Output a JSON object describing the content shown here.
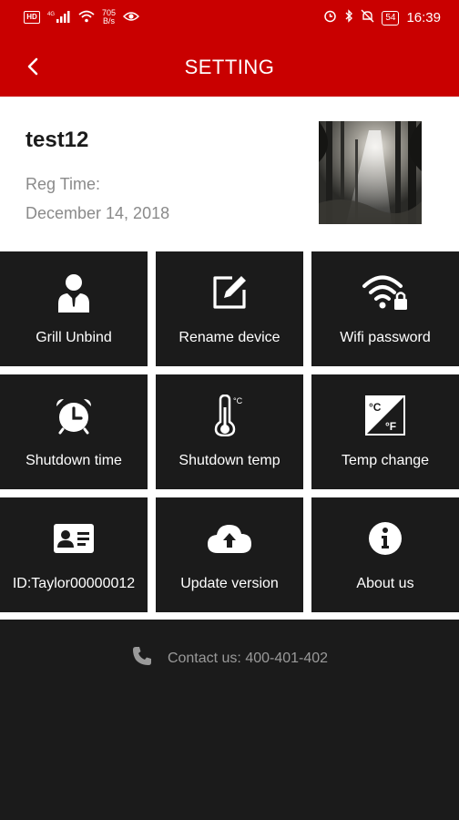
{
  "status_bar": {
    "hd_badge": "HD",
    "network": "4G",
    "speed_value": "705",
    "speed_unit": "B/s",
    "battery": "54",
    "time": "16:39"
  },
  "header": {
    "title": "SETTING"
  },
  "profile": {
    "device_name": "test12",
    "reg_label": "Reg Time:",
    "reg_date": "December 14, 2018"
  },
  "tiles": [
    {
      "label": "Grill Unbind",
      "icon": "user-tie-icon"
    },
    {
      "label": "Rename device",
      "icon": "edit-icon"
    },
    {
      "label": "Wifi password",
      "icon": "wifi-lock-icon"
    },
    {
      "label": "Shutdown time",
      "icon": "alarm-clock-icon"
    },
    {
      "label": "Shutdown temp",
      "icon": "thermometer-icon"
    },
    {
      "label": "Temp change",
      "icon": "celsius-fahrenheit-icon"
    },
    {
      "label": "ID:Taylor00000012",
      "icon": "id-card-icon"
    },
    {
      "label": "Update version",
      "icon": "cloud-upload-icon"
    },
    {
      "label": "About us",
      "icon": "info-icon"
    }
  ],
  "footer": {
    "contact": "Contact us: 400-401-402"
  },
  "colors": {
    "brand_red": "#c90000",
    "tile_bg": "#1b1b1b"
  }
}
